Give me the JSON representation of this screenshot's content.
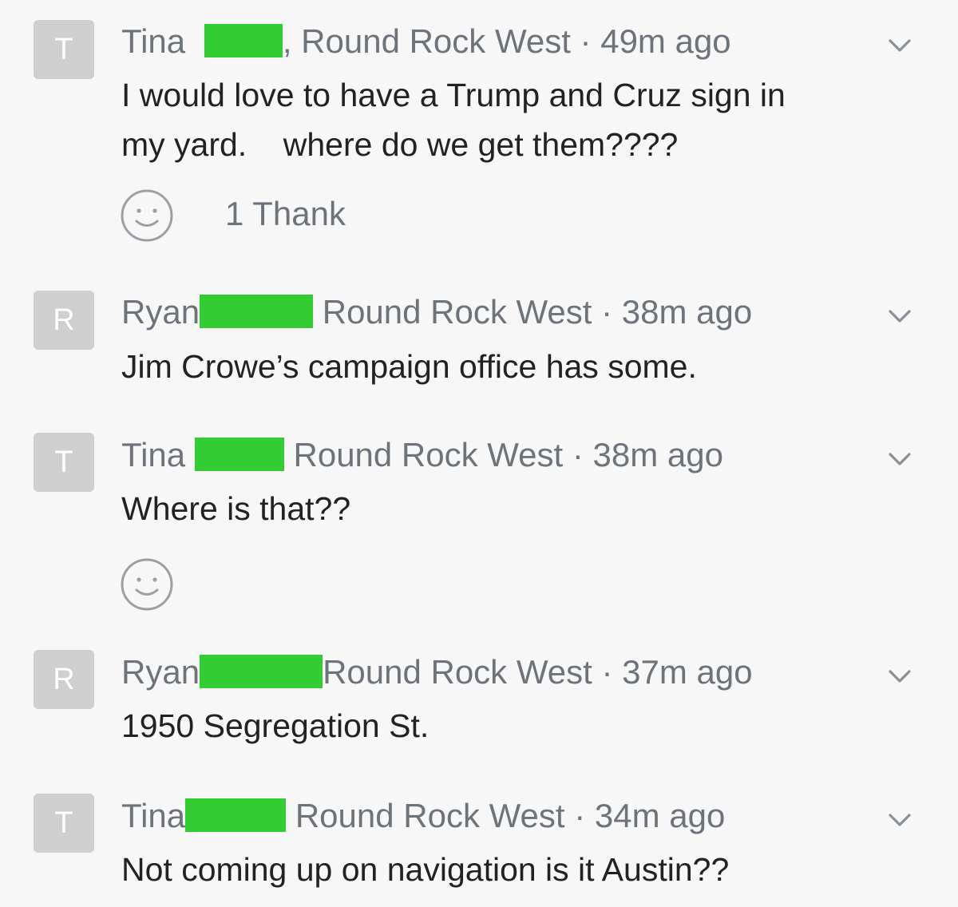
{
  "comments": [
    {
      "avatar_letter": "T",
      "author": "Tina",
      "author_suffix": ",",
      "location": "Round Rock West",
      "separator": "·",
      "time": "49m ago",
      "body_line1": "I would love to have a Trump and Cruz sign in",
      "body_line2": "my yard.    where do we get them????",
      "thank_count_label": "1 Thank"
    },
    {
      "avatar_letter": "R",
      "author": "Ryan",
      "location": "Round Rock West",
      "separator": "·",
      "time": "38m ago",
      "body_line1": "Jim Crowe’s campaign office has some."
    },
    {
      "avatar_letter": "T",
      "author": "Tina",
      "location": "Round Rock West",
      "separator": "·",
      "time": "38m ago",
      "body_line1": "Where is that??"
    },
    {
      "avatar_letter": "R",
      "author": "Ryan",
      "location": "Round Rock West",
      "separator": "·",
      "time": "37m ago",
      "body_line1": "1950 Segregation St."
    },
    {
      "avatar_letter": "T",
      "author": "Tina",
      "location": "Round Rock West",
      "separator": "·",
      "time": "34m ago",
      "body_line1": "Not coming up on navigation is it Austin??"
    }
  ],
  "icons": {
    "options": "chevron-down-icon",
    "thank": "smiley-icon"
  },
  "colors": {
    "background": "#f7f7f7",
    "redaction": "#33cc33",
    "avatar": "#cfcfcf",
    "meta_text": "#6d737a",
    "body_text": "#222222"
  }
}
